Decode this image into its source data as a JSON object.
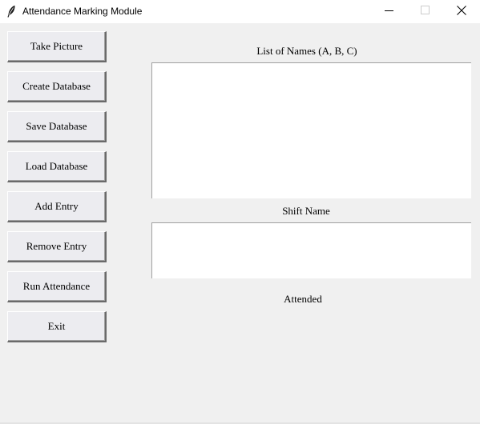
{
  "window": {
    "title": "Attendance Marking Module",
    "icon": "feather-icon"
  },
  "buttons": {
    "take_picture": "Take Picture",
    "create_database": "Create Database",
    "save_database": "Save Database",
    "load_database": "Load Database",
    "add_entry": "Add Entry",
    "remove_entry": "Remove Entry",
    "run_attendance": "Run Attendance",
    "exit": "Exit"
  },
  "fields": {
    "names_label": "List of Names (A, B, C)",
    "names_value": "",
    "shift_label": "Shift Name",
    "shift_value": ""
  },
  "status": {
    "attended_label": "Attended"
  },
  "colors": {
    "background": "#f0f0f0",
    "button_face": "#ececf0",
    "input_background": "#ffffff"
  }
}
